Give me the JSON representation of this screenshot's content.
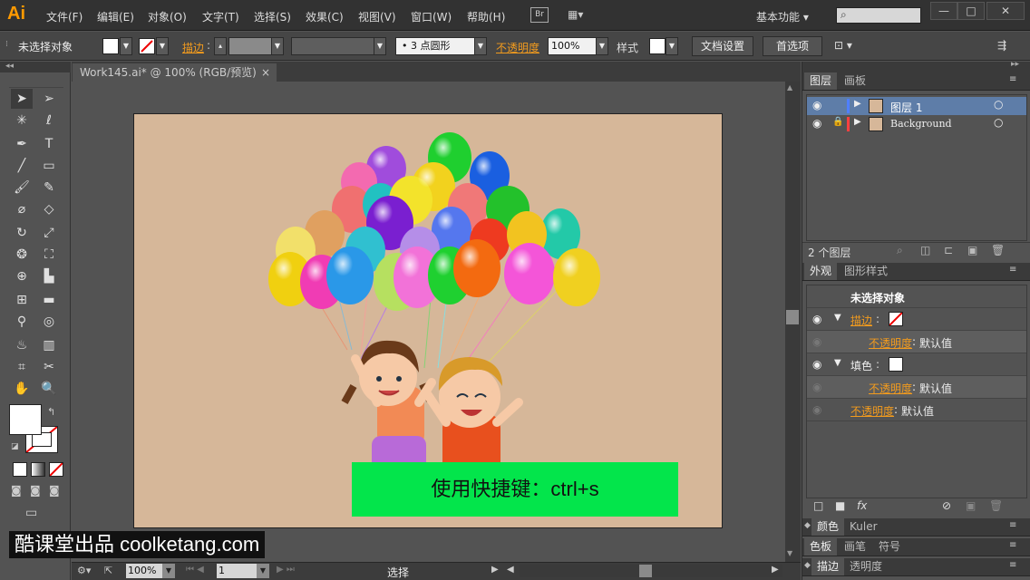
{
  "app": {
    "logo": "Ai",
    "workspace": "基本功能",
    "br_label": "Br"
  },
  "menu": [
    "文件(F)",
    "编辑(E)",
    "对象(O)",
    "文字(T)",
    "选择(S)",
    "效果(C)",
    "视图(V)",
    "窗口(W)",
    "帮助(H)"
  ],
  "window_buttons": {
    "minimize": "—",
    "restore": "□",
    "close": "✕"
  },
  "control": {
    "selection": "未选择对象",
    "stroke_label": "描边",
    "brush": "• 3 点圆形",
    "opacity_label": "不透明度",
    "opacity_value": "100%",
    "style_label": "样式",
    "doc_setup": "文档设置",
    "preferences": "首选项"
  },
  "document": {
    "tab_title": "Work145.ai* @ 100% (RGB/预览)",
    "tab_close": "×"
  },
  "status": {
    "zoom": "100%",
    "page": "1",
    "tool": "选择"
  },
  "layers_panel": {
    "tabs": [
      "图层",
      "画板"
    ],
    "layers": [
      {
        "name": "图层 1",
        "color": "#4f7fff"
      },
      {
        "name": "Background",
        "color": "#ff4040"
      }
    ],
    "count": "2 个图层"
  },
  "appearance_panel": {
    "tabs": [
      "外观",
      "图形样式"
    ],
    "title": "未选择对象",
    "stroke_label": "描边",
    "fill_label": "填色",
    "opacity_label": "不透明度",
    "opacity_default": "默认值",
    "fx_label": "fx"
  },
  "bottom_panels": [
    {
      "tabs": [
        "颜色",
        "Kuler"
      ]
    },
    {
      "tabs": [
        "色板",
        "画笔",
        "符号"
      ]
    },
    {
      "tabs": [
        "描边",
        "透明度"
      ]
    }
  ],
  "caption": "使用快捷键：ctrl+s",
  "watermark": "酷课堂出品 coolketang.com"
}
